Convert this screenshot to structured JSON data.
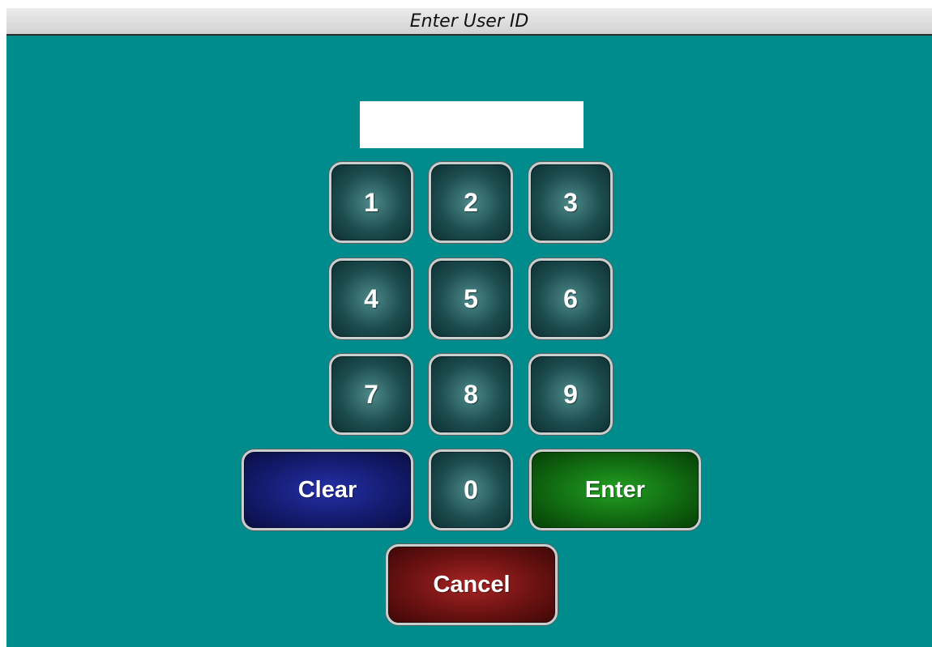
{
  "window": {
    "title": "Enter User ID"
  },
  "user_id_field": {
    "value": ""
  },
  "keypad": {
    "keys": {
      "k1": "1",
      "k2": "2",
      "k3": "3",
      "k4": "4",
      "k5": "5",
      "k6": "6",
      "k7": "7",
      "k8": "8",
      "k9": "9",
      "k0": "0"
    },
    "clear_label": "Clear",
    "enter_label": "Enter",
    "cancel_label": "Cancel"
  },
  "colors": {
    "background": "#008c8c",
    "clear_button": "#141c70",
    "enter_button": "#116a11",
    "cancel_button": "#6c1212",
    "digit_button": "#1d4d4f"
  }
}
